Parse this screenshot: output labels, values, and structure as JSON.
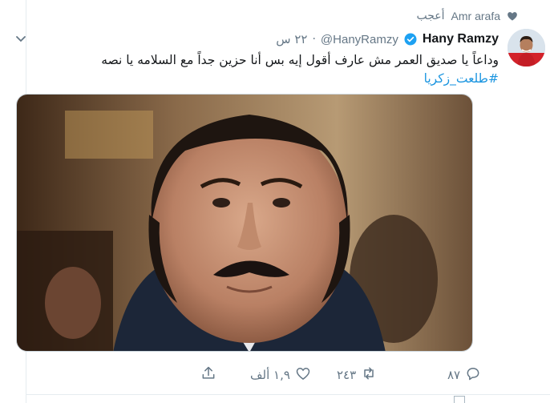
{
  "social_context": {
    "name": "Amr arafa",
    "action": "أعجب",
    "icon": "heart-icon"
  },
  "tweet": {
    "display_name": "Hany Ramzy",
    "verified": true,
    "handle": "@HanyRamzy",
    "separator": "·",
    "time": "٢٢ س",
    "text": "وداعاً يا صديق العمر  مش عارف أقول إيه بس أنا حزين جداً مع السلامه  يا نصه",
    "hashtag": "#طلعت_زكريا",
    "avatar_icon": "profile-photo",
    "media_alt": "photo"
  },
  "actions": {
    "reply_count": "٨٧",
    "retweet_count": "٢٤٣",
    "like_count": "١,٩ ألف",
    "icons": [
      "reply-icon",
      "retweet-icon",
      "heart-icon",
      "share-icon"
    ]
  },
  "colors": {
    "link": "#1b95e0",
    "verified": "#1da1f2",
    "muted": "#657786",
    "border": "#e6ecf0"
  }
}
